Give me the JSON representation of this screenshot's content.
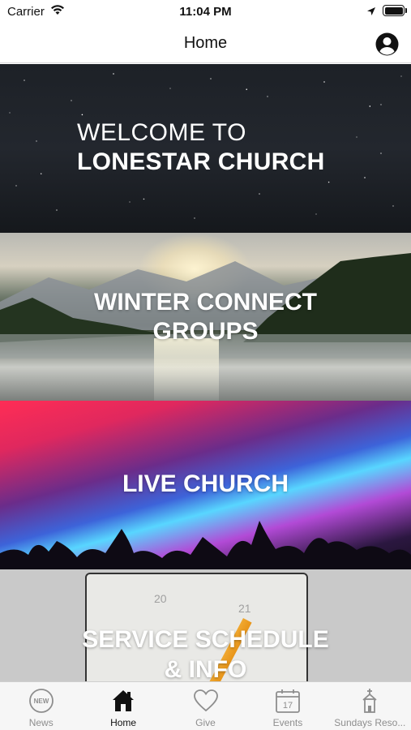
{
  "status_bar": {
    "carrier": "Carrier",
    "time": "11:04 PM"
  },
  "nav": {
    "title": "Home"
  },
  "banners": [
    {
      "line1": "WELCOME TO",
      "line2": "LONESTAR CHURCH"
    },
    {
      "line1": "WINTER CONNECT",
      "line2": "GROUPS"
    },
    {
      "line1": "LIVE CHURCH"
    },
    {
      "line1": "SERVICE SCHEDULE",
      "line2": "& INFO",
      "numbers": [
        "20",
        "21"
      ]
    }
  ],
  "tabs": [
    {
      "label": "News",
      "icon": "news-icon",
      "icon_text": "NEW"
    },
    {
      "label": "Home",
      "icon": "home-icon"
    },
    {
      "label": "Give",
      "icon": "heart-icon"
    },
    {
      "label": "Events",
      "icon": "calendar-icon",
      "icon_text": "17"
    },
    {
      "label": "Sundays Reso...",
      "icon": "church-icon"
    }
  ],
  "colors": {
    "active_tab": "#111111",
    "inactive_tab": "#8e8e8e"
  }
}
